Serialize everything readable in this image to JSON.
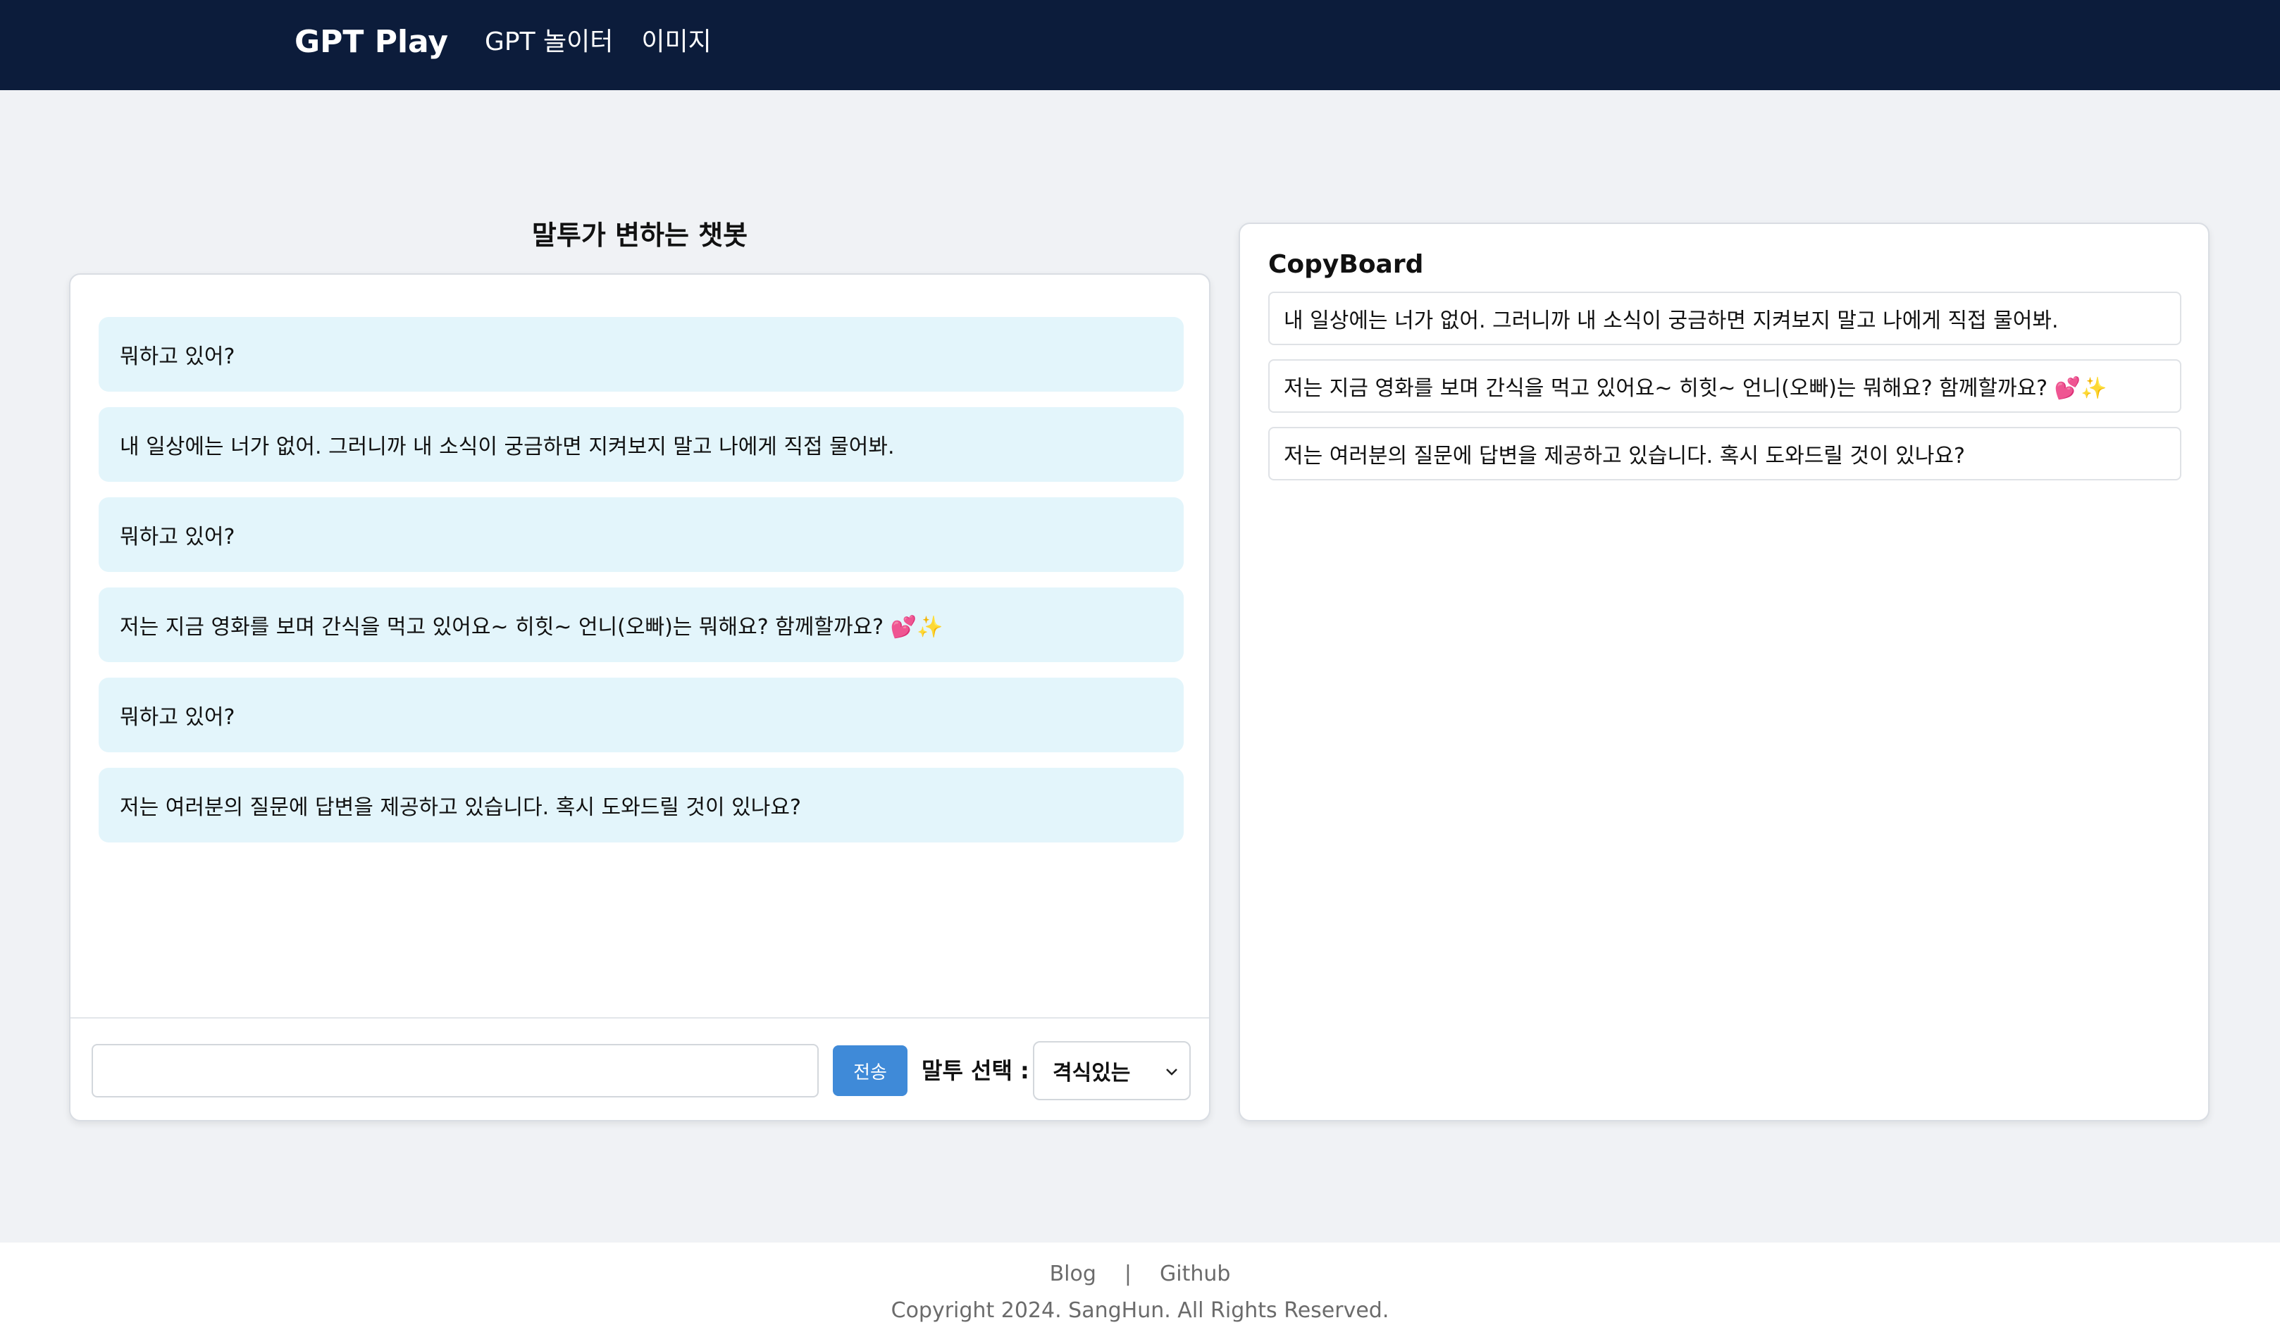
{
  "header": {
    "brand": "GPT Play",
    "nav": [
      "GPT 놀이터",
      "이미지"
    ]
  },
  "chat": {
    "title": "말투가 변하는 챗봇",
    "messages": [
      "뭐하고 있어?",
      "내 일상에는 너가 없어. 그러니까 내 소식이 궁금하면 지켜보지 말고 나에게 직접 물어봐.",
      "뭐하고 있어?",
      "저는 지금 영화를 보며 간식을 먹고 있어요~ 히힛~ 언니(오빠)는 뭐해요? 함께할까요? 💕✨",
      "뭐하고 있어?",
      "저는 여러분의 질문에 답변을 제공하고 있습니다. 혹시 도와드릴 것이 있나요?"
    ],
    "input_value": "",
    "send_label": "전송",
    "tone_label": "말투 선택 :",
    "tone_selected": "격식있는"
  },
  "copyboard": {
    "title": "CopyBoard",
    "items": [
      "내 일상에는 너가 없어. 그러니까 내 소식이 궁금하면 지켜보지 말고 나에게 직접 물어봐.",
      "저는 지금 영화를 보며 간식을 먹고 있어요~ 히힛~ 언니(오빠)는 뭐해요? 함께할까요? 💕✨",
      "저는 여러분의 질문에 답변을 제공하고 있습니다. 혹시 도와드릴 것이 있나요?"
    ]
  },
  "footer": {
    "links": [
      "Blog",
      "|",
      "Github"
    ],
    "copyright": "Copyright 2024. SangHun. All Rights Reserved."
  },
  "colors": {
    "header_bg": "#0c1c3b",
    "message_bg": "#e3f5fb",
    "send_button": "#3f8ad8",
    "page_bg": "#f0f2f5"
  }
}
